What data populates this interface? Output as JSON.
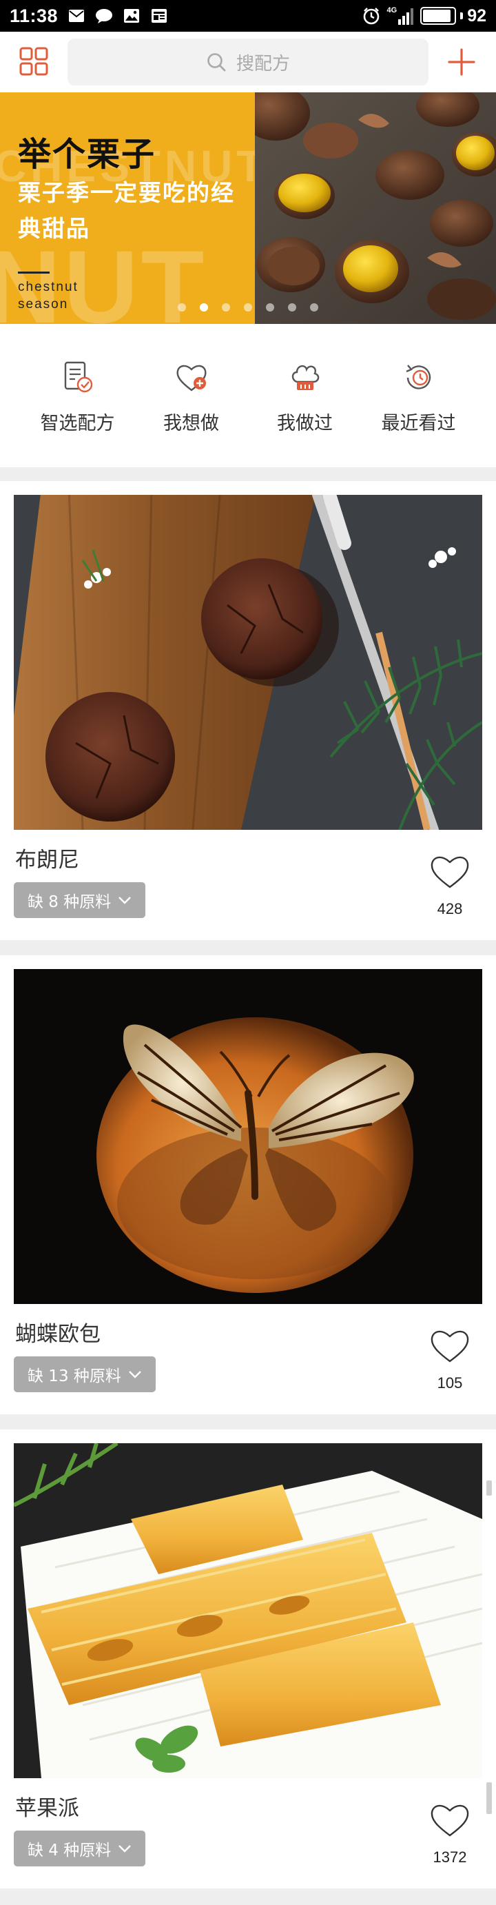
{
  "status_bar": {
    "time": "11:38",
    "network_label": "4G",
    "battery_percent": "92",
    "battery_level": 0.92,
    "icons": [
      "mail-icon",
      "chat-icon",
      "gallery-icon",
      "news-icon",
      "alarm-icon",
      "signal-icon",
      "battery-icon"
    ]
  },
  "header": {
    "search_placeholder": "搜配方",
    "icons": [
      "grid-menu-icon",
      "search-icon",
      "plus-icon"
    ]
  },
  "banner": {
    "title": "举个栗子",
    "subtitle": "栗子季一定要吃的经典甜品",
    "en_line1": "chestnut",
    "en_line2": "season",
    "ghost_1": "CHESTNUT",
    "ghost_2": "NUT",
    "carousel_active_index": 1,
    "carousel_count": 7
  },
  "quick_nav": [
    {
      "label": "智选配方",
      "icon": "smart-recipe-icon"
    },
    {
      "label": "我想做",
      "icon": "heart-plus-icon"
    },
    {
      "label": "我做过",
      "icon": "chef-hat-icon"
    },
    {
      "label": "最近看过",
      "icon": "history-clock-icon"
    }
  ],
  "recipes": [
    {
      "name": "布朗尼",
      "missing": "缺 8 种原料",
      "likes": "428",
      "photo": "brownie"
    },
    {
      "name": "蝴蝶欧包",
      "missing": "缺 13 种原料",
      "likes": "105",
      "photo": "butterfly-bread"
    },
    {
      "name": "苹果派",
      "missing": "缺 4 种原料",
      "likes": "1372",
      "photo": "apple-pie"
    }
  ],
  "colors": {
    "accent": "#e25c3b",
    "banner_yellow": "#f0ae1c",
    "button_gray": "#aaaaaa",
    "separator": "#eeeeee"
  }
}
